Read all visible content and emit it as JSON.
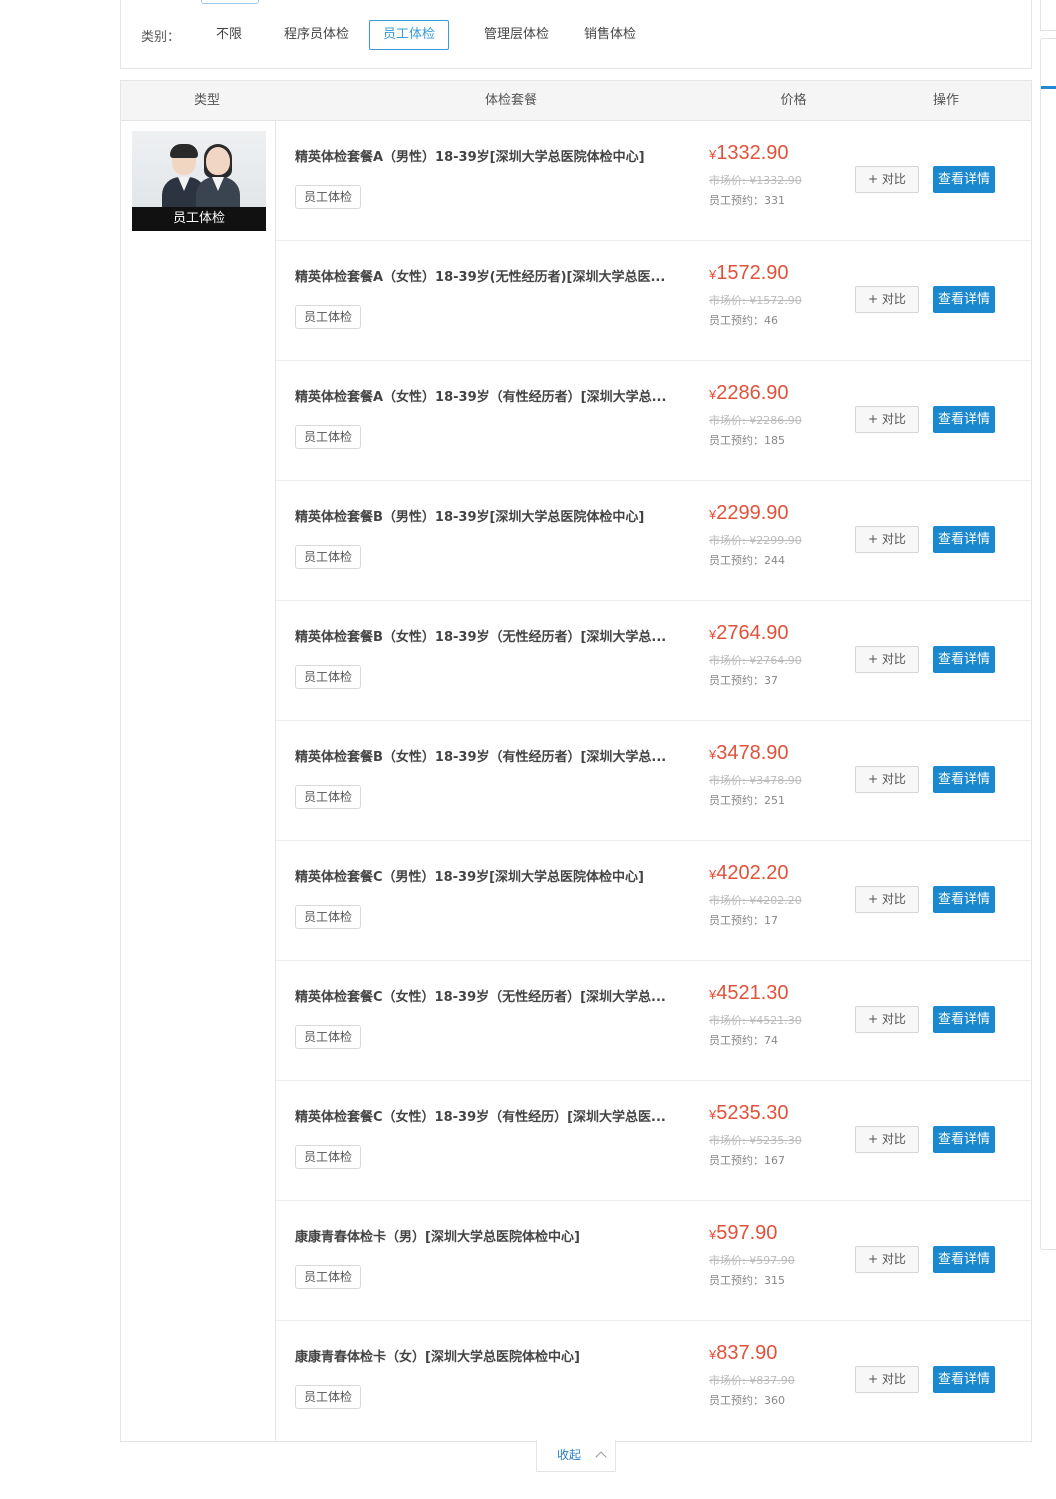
{
  "filter": {
    "label": "类别：",
    "options": [
      "不限",
      "程序员体检",
      "员工体检",
      "管理层体检",
      "销售体检"
    ],
    "selected": "员工体检"
  },
  "table": {
    "headers": [
      "类型",
      "体检套餐",
      "价格",
      "操作"
    ],
    "type_card_label": "员工体检",
    "compare_label": "对比",
    "detail_label": "查看详情",
    "currency": "¥",
    "rows": [
      {
        "name": "精英体检套餐A（男性）18-39岁[深圳大学总医院体检中心]",
        "tag": "员工体检",
        "price": "1332.90",
        "market": "市场价: ¥1332.90",
        "booked": "员工预约：331"
      },
      {
        "name": "精英体检套餐A（女性）18-39岁(无性经历者)[深圳大学总医...",
        "tag": "员工体检",
        "price": "1572.90",
        "market": "市场价: ¥1572.90",
        "booked": "员工预约：46"
      },
      {
        "name": "精英体检套餐A（女性）18-39岁（有性经历者）[深圳大学总...",
        "tag": "员工体检",
        "price": "2286.90",
        "market": "市场价: ¥2286.90",
        "booked": "员工预约：185"
      },
      {
        "name": "精英体检套餐B（男性）18-39岁[深圳大学总医院体检中心]",
        "tag": "员工体检",
        "price": "2299.90",
        "market": "市场价: ¥2299.90",
        "booked": "员工预约：244"
      },
      {
        "name": "精英体检套餐B（女性）18-39岁（无性经历者）[深圳大学总...",
        "tag": "员工体检",
        "price": "2764.90",
        "market": "市场价: ¥2764.90",
        "booked": "员工预约：37"
      },
      {
        "name": "精英体检套餐B（女性）18-39岁（有性经历者）[深圳大学总...",
        "tag": "员工体检",
        "price": "3478.90",
        "market": "市场价: ¥3478.90",
        "booked": "员工预约：251"
      },
      {
        "name": "精英体检套餐C（男性）18-39岁[深圳大学总医院体检中心]",
        "tag": "员工体检",
        "price": "4202.20",
        "market": "市场价: ¥4202.20",
        "booked": "员工预约：17"
      },
      {
        "name": "精英体检套餐C（女性）18-39岁（无性经历者）[深圳大学总...",
        "tag": "员工体检",
        "price": "4521.30",
        "market": "市场价: ¥4521.30",
        "booked": "员工预约：74"
      },
      {
        "name": "精英体检套餐C（女性）18-39岁（有性经历）[深圳大学总医...",
        "tag": "员工体检",
        "price": "5235.30",
        "market": "市场价: ¥5235.30",
        "booked": "员工预约：167"
      },
      {
        "name": "康康青春体检卡（男）[深圳大学总医院体检中心]",
        "tag": "员工体检",
        "price": "597.90",
        "market": "市场价: ¥597.90",
        "booked": "员工预约：315"
      },
      {
        "name": "康康青春体检卡（女）[深圳大学总医院体检中心]",
        "tag": "员工体检",
        "price": "837.90",
        "market": "市场价: ¥837.90",
        "booked": "员工预约：360"
      }
    ]
  },
  "collapse_label": "收起",
  "icons": {
    "compare": "plus-icon",
    "collapse": "chevron-up-icon"
  },
  "colors": {
    "accent": "#1a89d0",
    "price": "#e0523a",
    "selected_filter": "#3a9bd8"
  }
}
